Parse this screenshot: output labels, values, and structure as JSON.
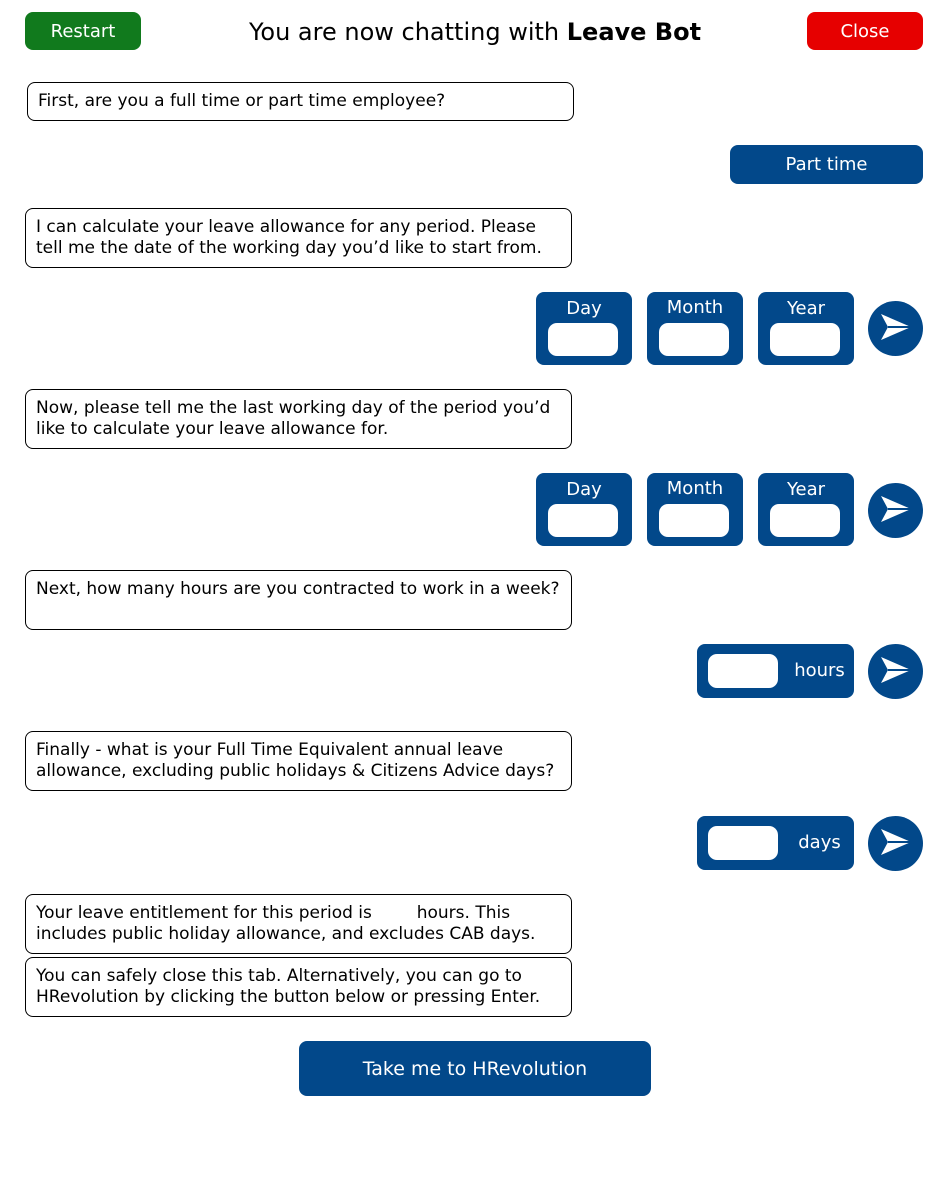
{
  "header": {
    "restart_label": "Restart",
    "title_prefix": "You are now chatting with",
    "bot_name": "Leave Bot",
    "close_label": "Close"
  },
  "messages": {
    "q1": "First, are you a full time or part time employee?",
    "a1": "Part time",
    "q2": "I can calculate your leave allowance for any period. Please tell me the date of the working day you’d like to start from.",
    "q3": "Now, please tell me the last working day of the period you’d like to calculate your leave allowance for.",
    "q4": "Next, how many hours are you contracted to work in a week?",
    "q5": "Finally - what is your Full Time Equivalent annual leave allowance, excluding public holidays & Citizens Advice days?",
    "result_prefix": "Your leave entitlement for this period is",
    "result_value": "",
    "result_suffix": "hours. This includes public holiday allowance, and excludes CAB days.",
    "closing": "You can safely close this tab. Alternatively, you can go to HRevolution by clicking the button below or pressing Enter."
  },
  "date_labels": {
    "day": "Day",
    "month": "Month",
    "year": "Year"
  },
  "units": {
    "hours": "hours",
    "days": "days"
  },
  "cta_label": "Take me to HRevolution",
  "icons": {
    "send": "send-icon"
  },
  "colors": {
    "primary": "#02488a",
    "restart": "#117a1d",
    "close": "#e60000"
  }
}
